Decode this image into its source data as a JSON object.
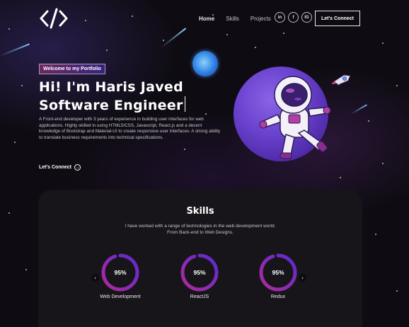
{
  "nav": {
    "links": [
      "Home",
      "Skills",
      "Projects"
    ],
    "social": [
      {
        "icon": "linkedin-icon",
        "glyph": "in"
      },
      {
        "icon": "facebook-icon",
        "glyph": "f"
      },
      {
        "icon": "instagram-icon",
        "glyph": "IG"
      }
    ],
    "connect_label": "Let's Connect"
  },
  "hero": {
    "tagline": "Welcome to my Portfolio",
    "headline_line1": "Hi! I'm Haris Javed",
    "headline_line2": "Software Engineer",
    "description": "A Front-end developer with 3 years of experience in building user interfaces for web applications. Highly skilled in using HTML5/CSS, Javascript, React.js and a decent knowledge of Bootstrap and Material-UI to create responsive user interfaces. A strong ability to translate business requirements into technical specifications.",
    "cta_label": "Let's Connect"
  },
  "skills": {
    "title": "Skills",
    "subtitle_line1": "I have worked with a range of technologies in the web development world.",
    "subtitle_line2": "From Back-end to Web Designs.",
    "items": [
      {
        "label": "Web Development",
        "percent": 95,
        "percent_text": "95%"
      },
      {
        "label": "ReactJS",
        "percent": 95,
        "percent_text": "95%"
      },
      {
        "label": "Redux",
        "percent": 95,
        "percent_text": "95%"
      }
    ],
    "prev_glyph": "‹",
    "next_glyph": "›"
  },
  "colors": {
    "background": "#0e0c12",
    "card": "#171519",
    "accent_purple": "#8e2de2",
    "accent_pink": "#aa367c",
    "ring_gradient_start": "#b02a9e",
    "ring_gradient_end": "#5a2bd0"
  }
}
